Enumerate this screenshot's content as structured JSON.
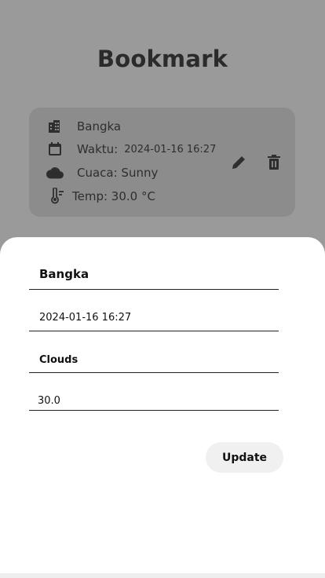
{
  "header": {
    "title": "Bookmark"
  },
  "card": {
    "city": "Bangka",
    "time_label": "Waktu:",
    "time_value": "2024-01-16 16:27",
    "weather": "Cuaca: Sunny",
    "temp": "Temp: 30.0 °C",
    "icons": [
      "city-icon",
      "calendar-icon",
      "cloud-icon",
      "thermometer-icon",
      "edit-icon",
      "delete-icon"
    ]
  },
  "sheet": {
    "fields": {
      "city": "Bangka",
      "time": "2024-01-16 16:27",
      "weather": "Clouds",
      "temp": "30.0"
    },
    "update_label": "Update"
  },
  "colors": {
    "backdrop": "#9a9a9a",
    "card": "#8c8c8c",
    "sheet": "#ffffff",
    "button": "#f0f0f0"
  }
}
